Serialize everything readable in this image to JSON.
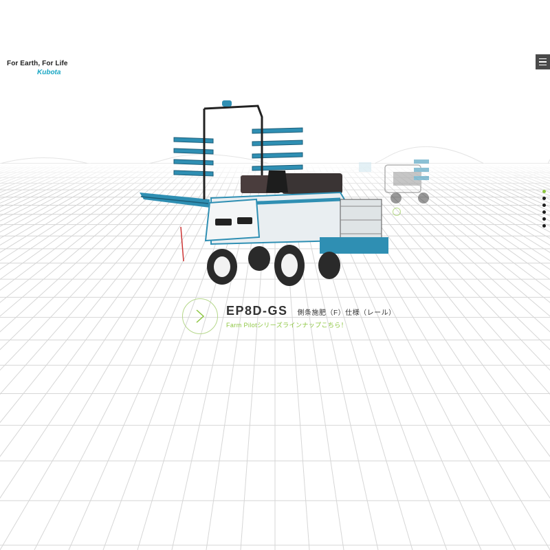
{
  "header": {
    "tagline": "For Earth, For Life",
    "logo_text": "Kubota"
  },
  "menu": {
    "icon": "hamburger-icon"
  },
  "pager": {
    "count": 6,
    "active_index": 0
  },
  "product": {
    "model": "EP8D-GS",
    "spec": "側条施肥（F）仕様（レール）",
    "lineup_link": "Farm Pilotシリーズラインナップこちら！",
    "icon": "chevron-right-icon"
  },
  "colors": {
    "accent_green": "#8cc63f",
    "brand_blue": "#1aa7c4",
    "machine_blue": "#2f8fb3",
    "dark": "#333333"
  }
}
